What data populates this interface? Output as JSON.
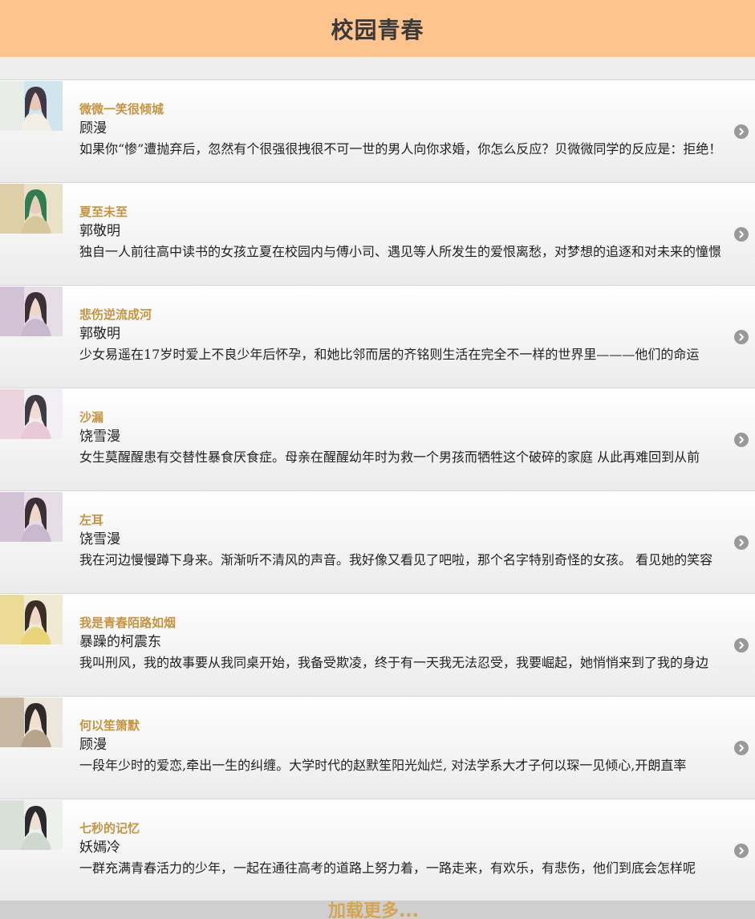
{
  "header": {
    "title": "校园青春"
  },
  "books": [
    {
      "title": "微微一笑很倾城",
      "author": "顾漫",
      "desc": "如果你“惨”遭抛弃后，忽然有个很强很拽很不可一世的男人向你求婚，你怎么反应？贝微微同学的反应是：拒绝！"
    },
    {
      "title": "夏至未至",
      "author": "郭敬明",
      "desc": "独自一人前往高中读书的女孩立夏在校园内与傅小司、遇见等人所发生的爱恨离愁，对梦想的追逐和对未来的憧憬"
    },
    {
      "title": "悲伤逆流成河",
      "author": "郭敬明",
      "desc": "少女易遥在17岁时爱上不良少年后怀孕，和她比邻而居的齐铭则生活在完全不一样的世界里———他们的命运"
    },
    {
      "title": "沙漏",
      "author": "饶雪漫",
      "desc": "女生莫醒醒患有交替性暴食厌食症。母亲在醒醒幼年时为救一个男孩而牺牲这个破碎的家庭 从此再难回到从前"
    },
    {
      "title": "左耳",
      "author": "饶雪漫",
      "desc": "我在河边慢慢蹲下身来。渐渐听不清风的声音。我好像又看见了吧啦，那个名字特别奇怪的女孩。 看见她的笑容"
    },
    {
      "title": "我是青春陌路如烟",
      "author": "暴躁的柯震东",
      "desc": "我叫刑风，我的故事要从我同桌开始，我备受欺凌，终于有一天我无法忍受，我要崛起，她悄悄来到了我的身边"
    },
    {
      "title": "何以笙箫默",
      "author": "顾漫",
      "desc": "一段年少时的爱恋,牵出一生的纠缠。大学时代的赵默笙阳光灿烂, 对法学系大才子何以琛一见倾心,开朗直率"
    },
    {
      "title": "七秒的记忆",
      "author": "妖嫣冷",
      "desc": "一群充满青春活力的少年，一起在通往高考的道路上努力着，一路走来，有欢乐，有悲伤，他们到底会怎样呢"
    }
  ],
  "load_more": {
    "label": "加载更多..."
  },
  "colors": {
    "header_bg": "#fdc48e",
    "title_accent": "#c7943f",
    "load_more_text": "#d6a550"
  },
  "icons": {
    "row_arrow": "chevron-right-circle-icon"
  }
}
